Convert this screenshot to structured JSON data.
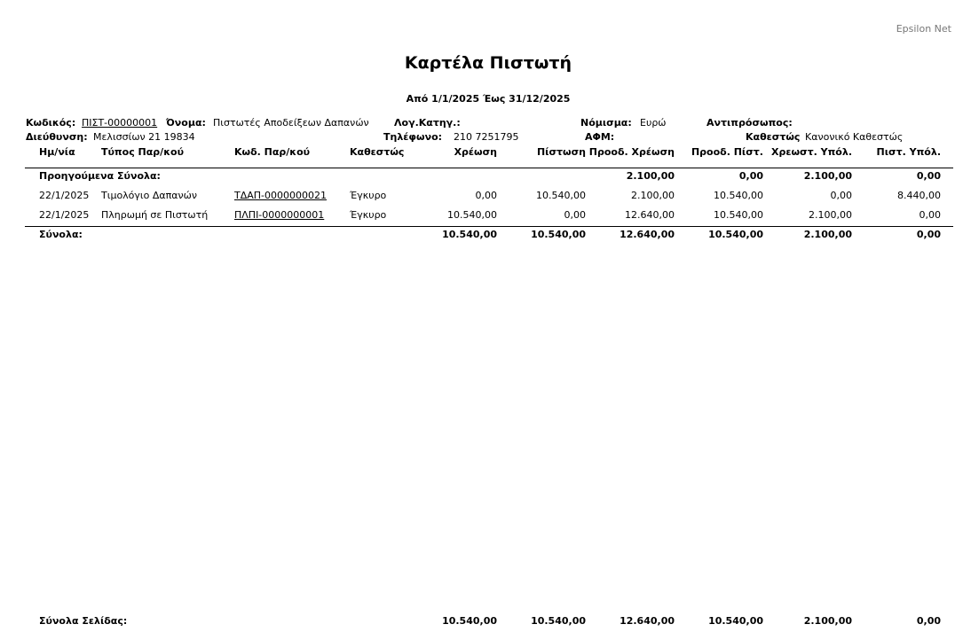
{
  "brand": "Epsilon Net",
  "title": "Καρτέλα Πιστωτή",
  "period": "Από 1/1/2025 Έως 31/12/2025",
  "info": {
    "code_label": "Κωδικός:",
    "code_value": "ΠΙΣΤ-00000001",
    "name_label": "Όνομα:",
    "name_value": "Πιστωτές Αποδείξεων Δαπανών",
    "logcat_label": "Λογ.Κατηγ.:",
    "currency_label": "Νόμισμα:",
    "currency_value": "Ευρώ",
    "rep_label": "Αντιπρόσωπος:",
    "address_label": "Διεύθυνση:",
    "address_value": "Μελισσίων 21 19834",
    "phone_label": "Τηλέφωνο:",
    "phone_value": "210 7251795",
    "afm_label": "ΑΦΜ:",
    "status_label": "Καθεστώς",
    "status_value": "Κανονικό Καθεστώς"
  },
  "columns": {
    "date": "Ημ/νία",
    "type": "Τύπος Παρ/κού",
    "code": "Κωδ. Παρ/κού",
    "status": "Καθεστώς",
    "debit": "Χρέωση",
    "credit": "Πίστωση",
    "prog_debit": "Προοδ. Χρέωση",
    "prog_credit": "Προοδ. Πίστ.",
    "debit_bal": "Χρεωστ. Υπόλ.",
    "credit_bal": "Πιστ. Υπόλ."
  },
  "previous": {
    "label": "Προηγούμενα Σύνολα:",
    "prog_debit": "2.100,00",
    "prog_credit": "0,00",
    "debit_bal": "2.100,00",
    "credit_bal": "0,00"
  },
  "rows": [
    {
      "date": "22/1/2025",
      "type": "Τιμολόγιο Δαπανών",
      "code": "ΤΔΑΠ-0000000021",
      "status": "Έγκυρο",
      "debit": "0,00",
      "credit": "10.540,00",
      "prog_debit": "2.100,00",
      "prog_credit": "10.540,00",
      "debit_bal": "0,00",
      "credit_bal": "8.440,00"
    },
    {
      "date": "22/1/2025",
      "type": "Πληρωμή σε Πιστωτή",
      "code": "ΠΛΠΙ-0000000001",
      "status": "Έγκυρο",
      "debit": "10.540,00",
      "credit": "0,00",
      "prog_debit": "12.640,00",
      "prog_credit": "10.540,00",
      "debit_bal": "2.100,00",
      "credit_bal": "0,00"
    }
  ],
  "totals": {
    "label": "Σύνολα:",
    "debit": "10.540,00",
    "credit": "10.540,00",
    "prog_debit": "12.640,00",
    "prog_credit": "10.540,00",
    "debit_bal": "2.100,00",
    "credit_bal": "0,00"
  },
  "page_totals": {
    "label": "Σύνολα Σελίδας:",
    "debit": "10.540,00",
    "credit": "10.540,00",
    "prog_debit": "12.640,00",
    "prog_credit": "10.540,00",
    "debit_bal": "2.100,00",
    "credit_bal": "0,00"
  }
}
